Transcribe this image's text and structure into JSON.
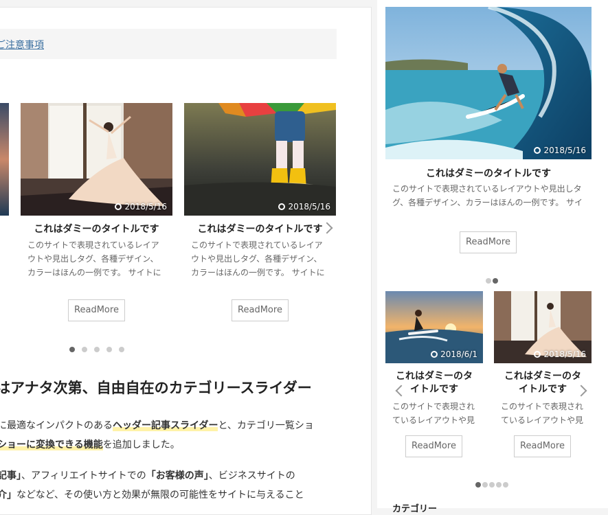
{
  "notice": {
    "link_text": "ご注意事項"
  },
  "main_slider": {
    "items": [
      {
        "date": "2018/5/16",
        "title": "これはダミーのタイトルです",
        "excerpt": "このサイトで表現されているレイアウトや見出しタグ、各種デザイン、カラーはほんの一例です。 サイトに用意さ",
        "button": "ReadMore",
        "image": "dancer-photo"
      },
      {
        "date": "2018/5/16",
        "title": "これはダミーのタイトルです",
        "excerpt": "このサイトで表現されているレイアウトや見出しタグ、各種デザイン、カラーはほんの一例です。 サイトに用意さ",
        "button": "ReadMore",
        "image": "rain-boots-photo"
      }
    ],
    "dots": 5,
    "active_dot": 0
  },
  "article": {
    "heading": "はアナタ次第、自由自在のカテゴリースライダー",
    "p1_a": "に最適なインパクトのある",
    "p1_b": "ヘッダー記事スライダー",
    "p1_c": "と、カテゴリ一覧ショ",
    "p2_a": "ショーに変換できる機能",
    "p2_b": "を追加しました。",
    "p3_a": "記事」",
    "p3_b": "、アフィリエイトサイトでの",
    "p3_c": "「お客様の声」",
    "p3_d": "、ビジネスサイトの",
    "p4_a": "介」",
    "p4_b": "などなど、その使い方と効果が無限の可能性をサイトに与えること"
  },
  "sidebar": {
    "top_slider": {
      "date": "2018/5/16",
      "title": "これはダミーのタイトルです",
      "excerpt": "このサイトで表現されているレイアウトや見出しタグ、各種デザイン、カラーはほんの一例です。 サイト",
      "button": "ReadMore",
      "image": "surfer-photo",
      "dots": 2,
      "active_dot": 1
    },
    "bottom_slider": {
      "items": [
        {
          "date": "2018/6/1",
          "title": "これはダミーのタイトルです",
          "excerpt": "このサイトで表現されているレイアウトや見",
          "button": "ReadMore",
          "image": "sunset-surfer-photo"
        },
        {
          "date": "2018/5/16",
          "title": "これはダミーのタイトルです",
          "excerpt": "このサイトで表現されているレイアウトや見",
          "button": "ReadMore",
          "image": "dancer-photo"
        }
      ],
      "dots": 5,
      "active_dot": 0
    },
    "category_heading": "カテゴリー"
  }
}
